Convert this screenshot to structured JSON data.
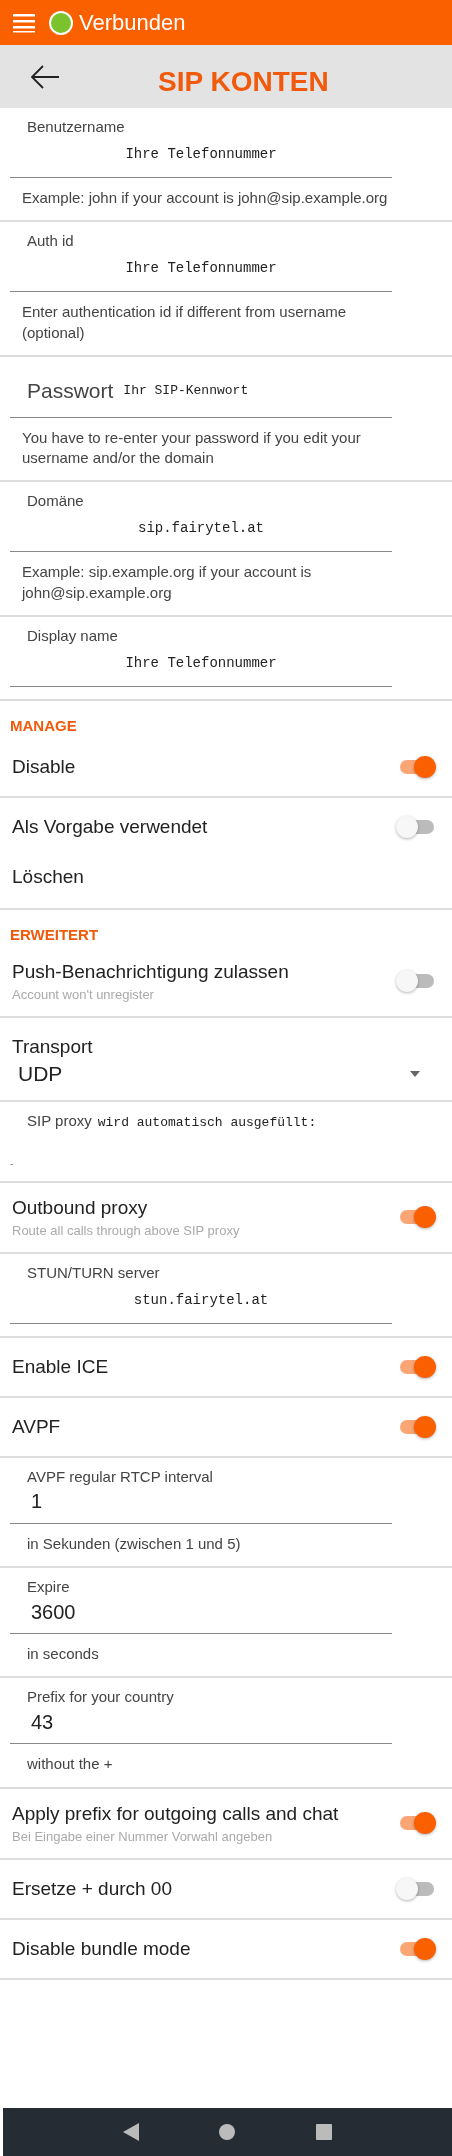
{
  "status_bar": {
    "label": "Verbunden"
  },
  "header": {
    "title": "SIP KONTEN"
  },
  "groups": [
    {
      "items": [
        {
          "kind": "text_field",
          "label": "Benutzername",
          "value": "Ihre Telefonnummer",
          "hint": "Example: john if your account is john@sip.example.org"
        }
      ]
    },
    {
      "items": [
        {
          "kind": "text_field",
          "label": "Auth id",
          "value": "Ihre Telefonnummer",
          "hint": "Enter authentication id if different from username (optional)"
        }
      ]
    },
    {
      "items": [
        {
          "kind": "inline_field",
          "label": "Passwort",
          "value": "Ihr SIP-Kennwort",
          "hint": "You have to re-enter your password if you edit your username and/or the domain"
        }
      ]
    },
    {
      "items": [
        {
          "kind": "text_field",
          "label": "Domäne",
          "value": "sip.fairytel.at",
          "hint": "Example: sip.example.org if your account is john@sip.example.org"
        }
      ]
    },
    {
      "items": [
        {
          "kind": "text_field",
          "label": "Display name",
          "value": "Ihre Telefonnummer"
        }
      ]
    },
    {
      "title": "MANAGE",
      "items": [
        {
          "kind": "toggle",
          "label": "Disable",
          "on": true
        }
      ]
    },
    {
      "items": [
        {
          "kind": "toggle",
          "label": "Als Vorgabe verwendet",
          "on": false
        },
        {
          "kind": "action",
          "label": "Löschen"
        }
      ]
    },
    {
      "title": "ERWEITERT",
      "items": [
        {
          "kind": "toggle",
          "label": "Push-Benachrichtigung zulassen",
          "sub": "Account won't unregister",
          "on": false
        }
      ]
    },
    {
      "items": [
        {
          "kind": "select",
          "label": "Transport",
          "value": "UDP"
        }
      ]
    },
    {
      "items": [
        {
          "kind": "proxy_field",
          "label": "SIP proxy",
          "value": "wird automatisch ausgefüllt:",
          "extra": "-"
        }
      ]
    },
    {
      "items": [
        {
          "kind": "toggle",
          "label": "Outbound proxy",
          "sub": "Route all calls through above SIP proxy",
          "on": true
        }
      ]
    },
    {
      "items": [
        {
          "kind": "text_field",
          "label": "STUN/TURN server",
          "value": "stun.fairytel.at"
        }
      ]
    },
    {
      "items": [
        {
          "kind": "toggle",
          "label": "Enable ICE",
          "on": true
        }
      ]
    },
    {
      "items": [
        {
          "kind": "toggle",
          "label": "AVPF",
          "on": true
        }
      ]
    },
    {
      "items": [
        {
          "kind": "number_field",
          "label": "AVPF regular RTCP interval",
          "value": "1",
          "hint": "in Sekunden (zwischen 1 und 5)"
        }
      ]
    },
    {
      "items": [
        {
          "kind": "number_field",
          "label": "Expire",
          "value": "3600",
          "hint": "in seconds"
        }
      ]
    },
    {
      "items": [
        {
          "kind": "number_field",
          "label": "Prefix for your country",
          "value": "43",
          "hint": "without the +"
        }
      ]
    },
    {
      "items": [
        {
          "kind": "toggle",
          "label": "Apply prefix for outgoing calls and chat",
          "sub": "Bei Eingabe einer Nummer Vorwahl angeben",
          "on": true
        }
      ]
    },
    {
      "items": [
        {
          "kind": "toggle",
          "label": "Ersetze + durch 00",
          "on": false
        }
      ]
    },
    {
      "items": [
        {
          "kind": "toggle",
          "label": "Disable bundle mode",
          "on": true
        }
      ]
    }
  ]
}
